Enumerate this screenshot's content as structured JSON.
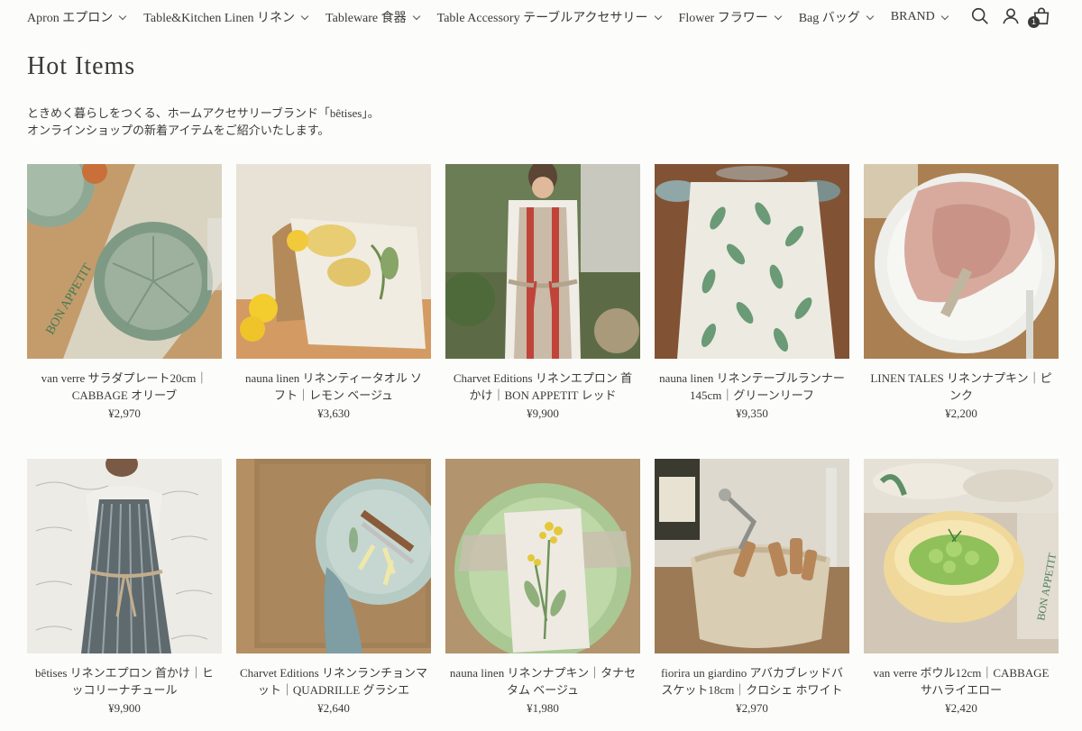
{
  "nav": {
    "items": [
      {
        "label": "Apron エプロン"
      },
      {
        "label": "Table&Kitchen Linen リネン"
      },
      {
        "label": "Tableware 食器"
      },
      {
        "label": "Table Accessory テーブルアクセサリー"
      },
      {
        "label": "Flower フラワー"
      },
      {
        "label": "Bag バッグ"
      },
      {
        "label": "BRAND"
      }
    ],
    "icons": [
      "search-icon",
      "account-icon",
      "cart-icon"
    ],
    "cart_count": "1"
  },
  "page": {
    "title": "Hot Items",
    "intro_line1": "ときめく暮らしをつくる、ホームアクセサリーブランド「bêtises」。",
    "intro_line2": "オンラインショップの新着アイテムをご紹介いたします。"
  },
  "products": [
    {
      "name": "van verre サラダプレート20cm｜CABBAGE オリーブ",
      "price": "¥2,970"
    },
    {
      "name": "nauna linen リネンティータオル ソフト｜レモン ベージュ",
      "price": "¥3,630"
    },
    {
      "name": "Charvet Editions リネンエプロン 首かけ｜BON APPETIT レッド",
      "price": "¥9,900"
    },
    {
      "name": "nauna linen リネンテーブルランナー 145cm｜グリーンリーフ",
      "price": "¥9,350"
    },
    {
      "name": "LINEN TALES リネンナプキン｜ピンク",
      "price": "¥2,200"
    },
    {
      "name": "bêtises リネンエプロン 首かけ｜ヒッコリーナチュール",
      "price": "¥9,900"
    },
    {
      "name": "Charvet Editions リネンランチョンマット｜QUADRILLE グラシエ",
      "price": "¥2,640"
    },
    {
      "name": "nauna linen リネンナプキン｜タナセタム ベージュ",
      "price": "¥1,980"
    },
    {
      "name": "fiorira un giardino アバカブレッドバスケット18cm｜クロシェ ホワイト",
      "price": "¥2,970"
    },
    {
      "name": "van verre ボウル12cm｜CABBAGE サハライエロー",
      "price": "¥2,420"
    }
  ],
  "colors": {
    "text": "#3a3a38",
    "background": "#fcfcfa"
  }
}
